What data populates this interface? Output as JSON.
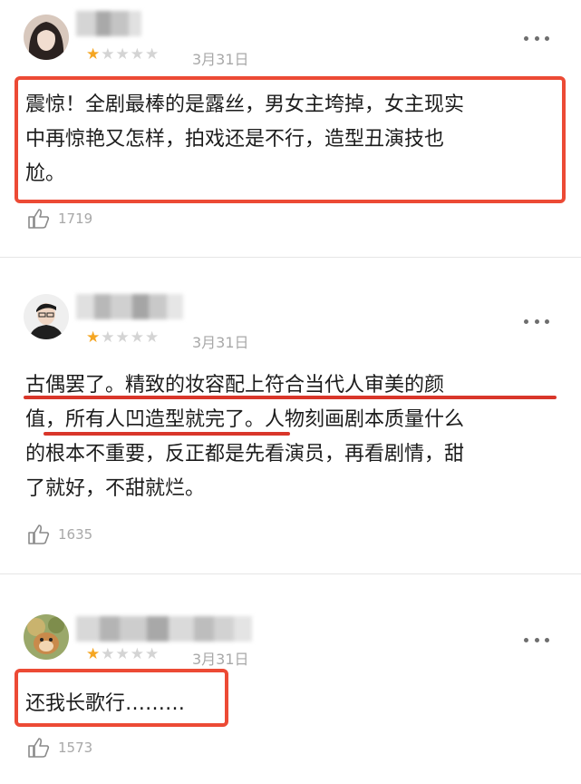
{
  "reviews": [
    {
      "rating": 1,
      "max_rating": 5,
      "date": "3月31日",
      "text_lines": [
        "震惊！全剧最棒的是露丝，男女主垮掉，女主现实",
        "中再惊艳又怎样，拍戏还是不行，造型丑演技也",
        "尬。"
      ],
      "likes": "1719"
    },
    {
      "rating": 1,
      "max_rating": 5,
      "date": "3月31日",
      "text_lines": [
        "古偶罢了。精致的妆容配上符合当代人审美的颜",
        "值，所有人凹造型就完了。人物刻画剧本质量什么",
        "的根本不重要，反正都是先看演员，再看剧情，甜",
        "了就好，不甜就烂。"
      ],
      "likes": "1635"
    },
    {
      "rating": 1,
      "max_rating": 5,
      "date": "3月31日",
      "text_lines": [
        "还我长歌行………"
      ],
      "likes": "1573"
    }
  ],
  "icons": {
    "star": "star-icon",
    "more": "more-dots-icon",
    "like": "thumbs-up-icon"
  },
  "colors": {
    "highlight": "#ec4a35",
    "star_on": "#f5a623",
    "star_off": "#d4d4d4",
    "meta": "#a8a8a8"
  }
}
